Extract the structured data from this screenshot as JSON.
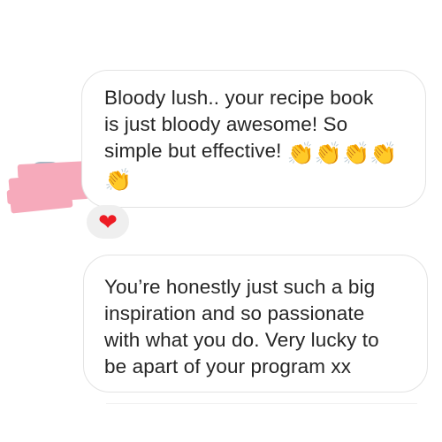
{
  "messages": [
    {
      "lines": [
        "Bloody lush.. your recipe book",
        "is just bloody awesome! So",
        "simple but effective!"
      ],
      "emoji": {
        "icon": "clapping-hands-icon",
        "glyph": "👏",
        "count": 5
      },
      "reaction": {
        "icon": "heart-icon",
        "glyph": "❤"
      }
    },
    {
      "lines": [
        "You’re honestly just such a big",
        "inspiration and so passionate",
        "with what you do. Very lucky to",
        "be apart of your program xx"
      ]
    }
  ],
  "colors": {
    "text": "#262626",
    "bubble_border": "#e3e3e3",
    "reaction_bg": "#efefef",
    "heart": "#ed1c24",
    "redaction": "#f6aabb"
  }
}
